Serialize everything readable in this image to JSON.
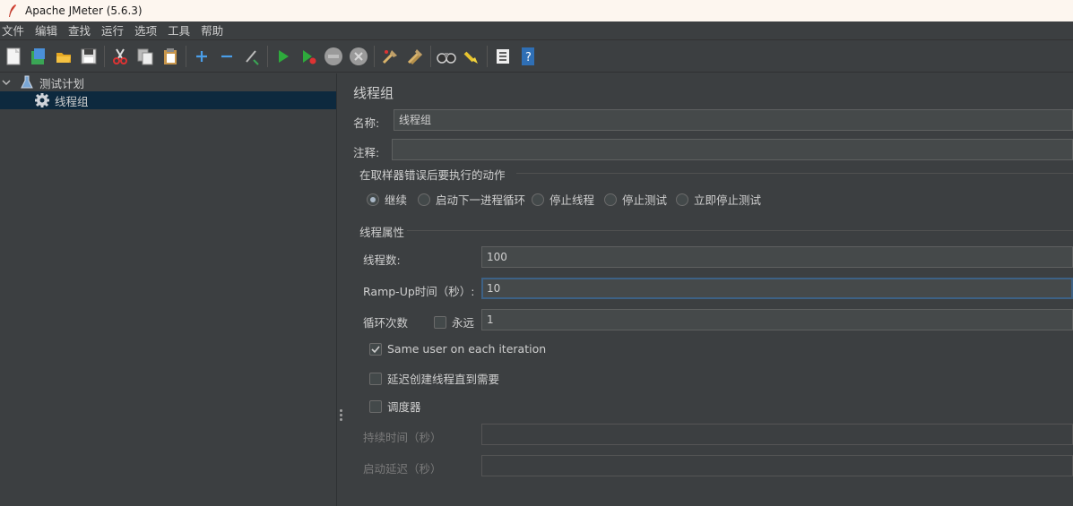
{
  "window": {
    "title": "Apache JMeter (5.6.3)"
  },
  "menu": [
    "文件",
    "编辑",
    "查找",
    "运行",
    "选项",
    "工具",
    "帮助"
  ],
  "toolbar": {
    "icons": [
      "new-icon",
      "templates-icon",
      "open-icon",
      "save-icon",
      "cut-icon",
      "copy-icon",
      "paste-icon",
      "expand-icon",
      "collapse-icon",
      "toggle-icon",
      "start-icon",
      "start-no-pause-icon",
      "stop-icon",
      "shutdown-icon",
      "clear-icon",
      "clear-all-icon",
      "search-icon",
      "reset-search-icon",
      "function-helper-icon",
      "help-icon"
    ]
  },
  "tree": {
    "root": {
      "label": "测试计划",
      "icon": "flask-icon",
      "expanded": true
    },
    "child": {
      "label": "线程组",
      "icon": "gear-icon",
      "selected": true
    }
  },
  "panel": {
    "title": "线程组",
    "name_label": "名称:",
    "name_value": "线程组",
    "comment_label": "注释:",
    "comment_value": "",
    "on_error": {
      "title": "在取样器错误后要执行的动作",
      "options": [
        "继续",
        "启动下一进程循环",
        "停止线程",
        "停止测试",
        "立即停止测试"
      ],
      "selected": "继续"
    },
    "thread_props": {
      "title": "线程属性",
      "threads_label": "线程数:",
      "threads_value": "100",
      "rampup_label": "Ramp-Up时间（秒）:",
      "rampup_value": "10",
      "loop_label": "循环次数",
      "forever_label": "永远",
      "forever_checked": false,
      "loop_value": "1",
      "same_user_label": "Same user on each iteration",
      "same_user_checked": true,
      "delay_label": "延迟创建线程直到需要",
      "delay_checked": false,
      "scheduler_label": "调度器",
      "scheduler_checked": false,
      "duration_label": "持续时间（秒）",
      "duration_value": "",
      "startup_delay_label": "启动延迟（秒）",
      "startup_delay_value": ""
    }
  },
  "colors": {
    "background": "#3c3f41",
    "selection": "#0d293e",
    "focus_border": "#3d6185"
  }
}
